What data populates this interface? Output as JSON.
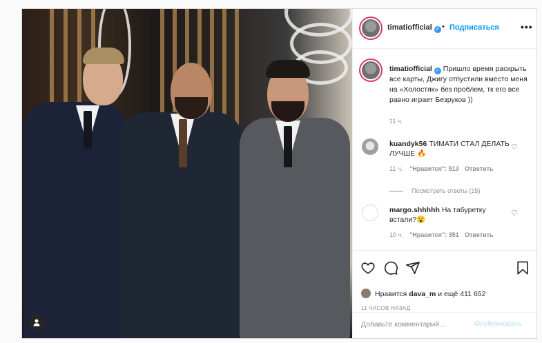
{
  "post": {
    "username": "timatiofficial",
    "follow_label": "Подписаться",
    "dot": "•",
    "more_label": "•••",
    "caption_user": "timatiofficial",
    "caption_text": "Пришло время раскрыть все карты, Джигу отпустили вместо меня на «Холостяк» без проблем, тк его все равно играет Безруков ))",
    "caption_time": "11 ч."
  },
  "comments": [
    {
      "user": "kuandyk56",
      "text": "ТИМАТИ СТАЛ ДЕЛАТЬ ЛУЧШЕ 🔥",
      "time": "11 ч.",
      "likes": "\"Нравится\": 513",
      "reply": "Ответить"
    },
    {
      "user": "margo.shhhhh",
      "text": "На табуретку встали?😮",
      "time": "10 ч.",
      "likes": "\"Нравится\": 351",
      "reply": "Ответить"
    }
  ],
  "view_replies": "Посмотреть ответы (15)",
  "likes": {
    "prefix": "Нравится",
    "user": "dava_m",
    "suffix": "и ещё 411 652"
  },
  "timestamp": "11 ЧАСОВ НАЗАД",
  "add_comment": {
    "placeholder": "Добавьте комментарий...",
    "publish_label": "Опубликовать"
  },
  "colors": {
    "accent": "#0095f6",
    "border": "#dbdbdb",
    "text": "#262626",
    "muted": "#8e8e8e"
  },
  "icons": [
    "heart-icon",
    "comment-icon",
    "share-icon",
    "bookmark-icon",
    "user-tag-icon",
    "verified-badge-icon",
    "more-options-icon"
  ]
}
